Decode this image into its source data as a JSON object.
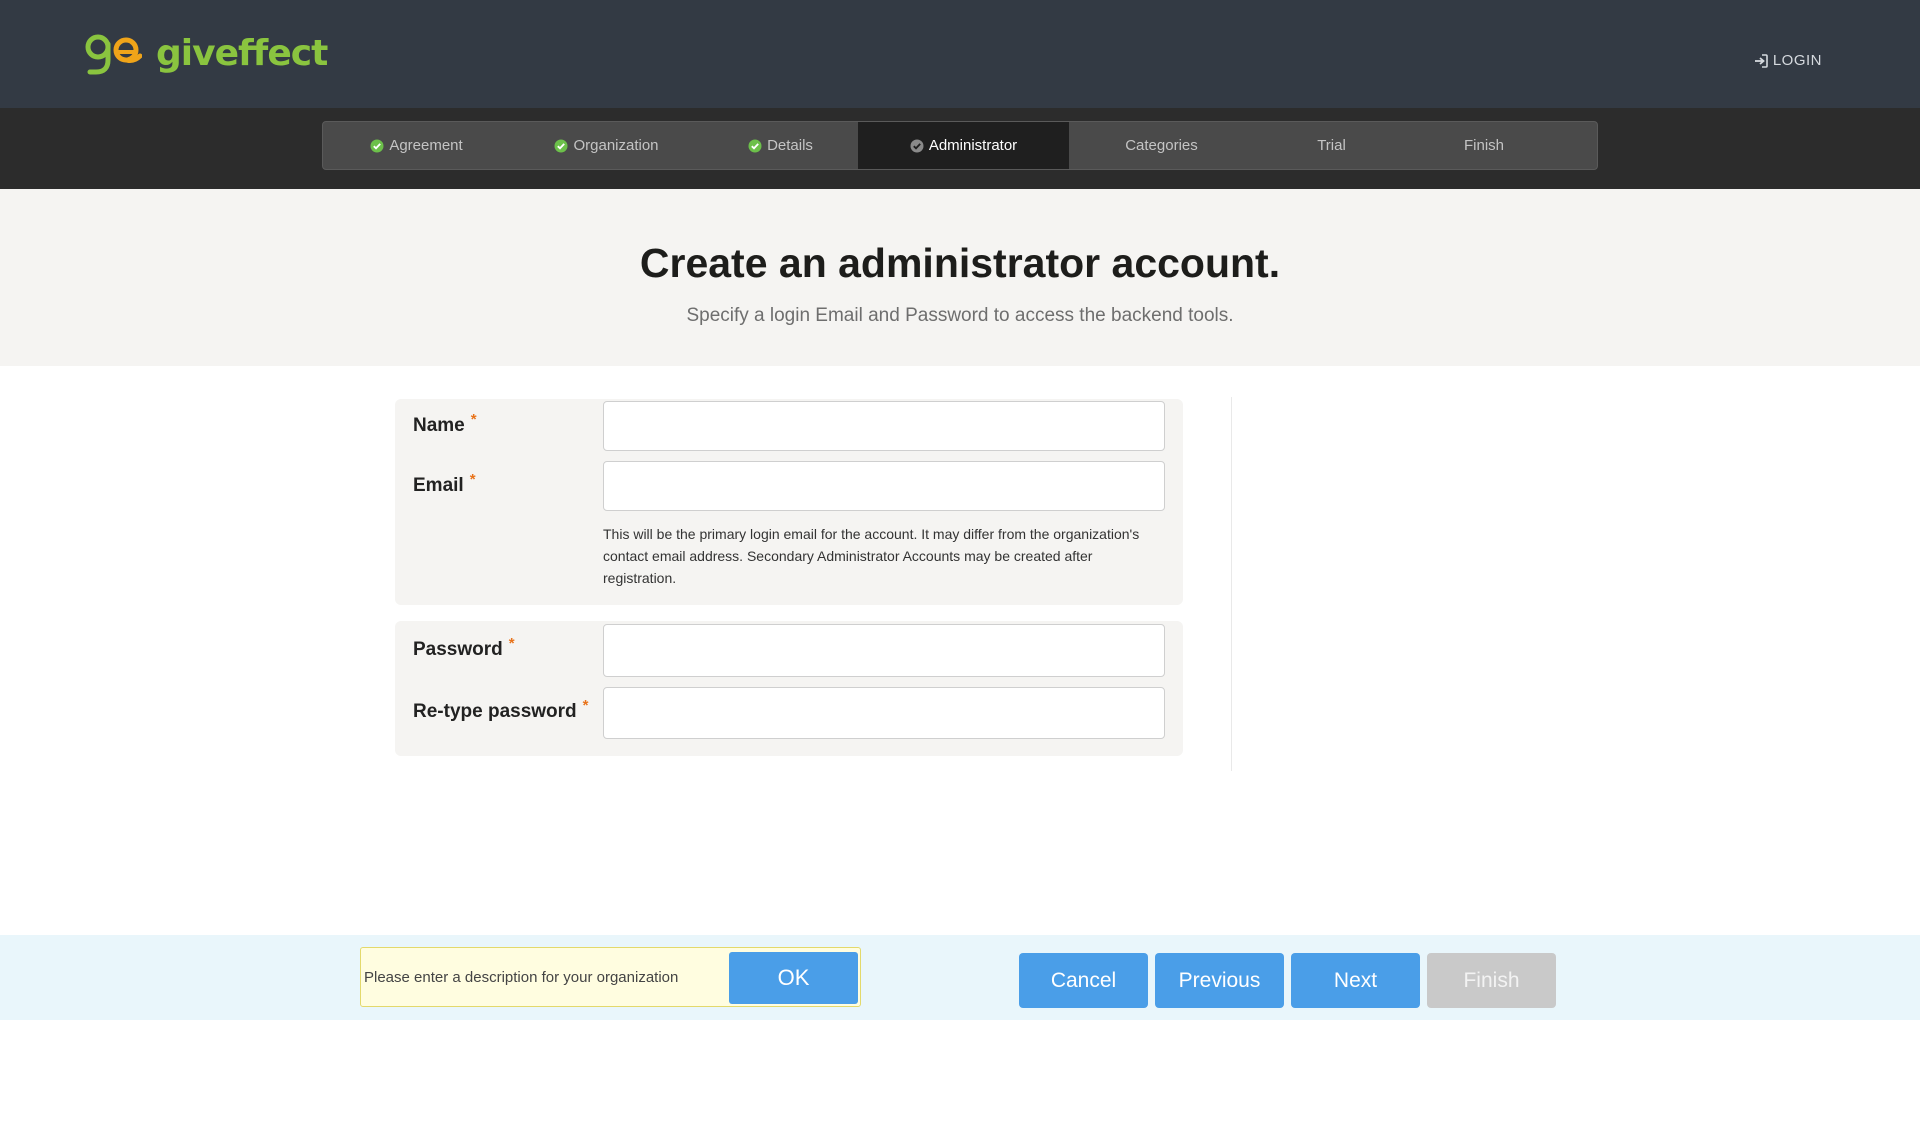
{
  "header": {
    "brand": "giveffect",
    "logo_icon": "giveffect-logo-mark",
    "login_label": "LOGIN",
    "login_icon": "sign-in-icon",
    "brand_color": "#8ac43f",
    "logo_accent_color": "#f0a419"
  },
  "steps": [
    {
      "label": "Agreement",
      "state": "done"
    },
    {
      "label": "Organization",
      "state": "done"
    },
    {
      "label": "Details",
      "state": "done"
    },
    {
      "label": "Administrator",
      "state": "current"
    },
    {
      "label": "Categories",
      "state": "todo"
    },
    {
      "label": "Trial",
      "state": "todo"
    },
    {
      "label": "Finish",
      "state": "todo"
    }
  ],
  "hero": {
    "title": "Create an administrator account.",
    "subtitle": "Specify a login Email and Password to access the backend tools."
  },
  "form": {
    "required_marker": "*",
    "name": {
      "label": "Name",
      "value": ""
    },
    "email": {
      "label": "Email",
      "value": "",
      "hint": "This will be the primary login email for the account. It may differ from the organization's contact email address. Secondary Administrator Accounts may be created after registration."
    },
    "password": {
      "label": "Password",
      "value": ""
    },
    "retype_password": {
      "label": "Re-type password",
      "value": ""
    }
  },
  "footer": {
    "description_prompt": "Please enter a description for your organization",
    "ok_label": "OK",
    "cancel_label": "Cancel",
    "previous_label": "Previous",
    "next_label": "Next",
    "finish_label": "Finish",
    "finish_disabled": true,
    "button_color": "#4a9ee8"
  },
  "colors": {
    "header_bg": "#333a44",
    "steps_bg": "#2c2c2c",
    "check_green": "#6cc04a",
    "required_orange": "#e8731b"
  }
}
